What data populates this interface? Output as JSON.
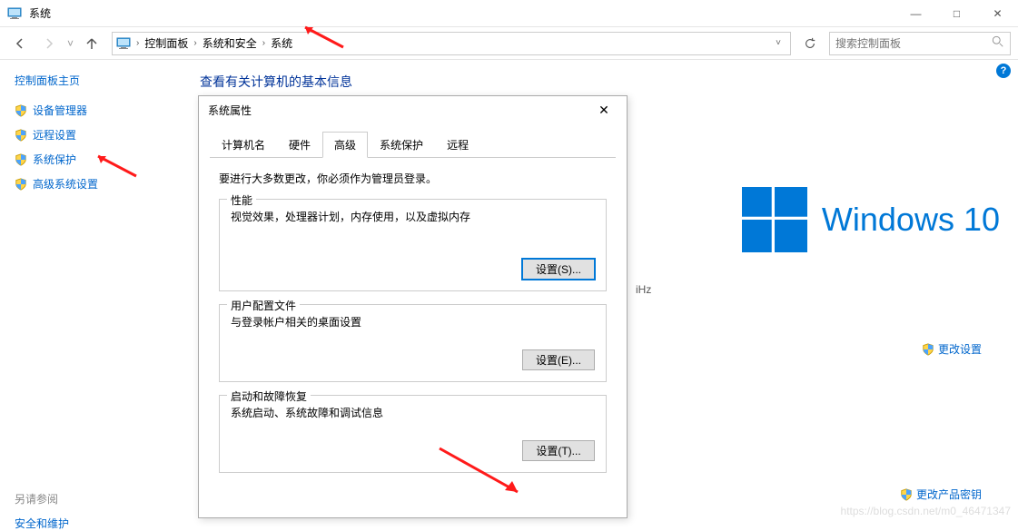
{
  "window": {
    "title": "系统",
    "minimize": "—",
    "maximize": "□",
    "close": "✕"
  },
  "nav": {
    "breadcrumbs": [
      "控制面板",
      "系统和安全",
      "系统"
    ],
    "search_placeholder": "搜索控制面板"
  },
  "sidebar": {
    "home": "控制面板主页",
    "items": [
      "设备管理器",
      "远程设置",
      "系统保护",
      "高级系统设置"
    ],
    "also_ref": "另请参阅",
    "sub": "安全和维护"
  },
  "content": {
    "heading": "查看有关计算机的基本信息",
    "ghz_snippet": "iHz",
    "win_brand": "Windows 10",
    "change_settings": "更改设置",
    "change_key": "更改产品密钥"
  },
  "dialog": {
    "title": "系统属性",
    "tabs": [
      "计算机名",
      "硬件",
      "高级",
      "系统保护",
      "远程"
    ],
    "active_tab": 2,
    "admin_note": "要进行大多数更改，你必须作为管理员登录。",
    "sections": [
      {
        "legend": "性能",
        "desc": "视觉效果，处理器计划，内存使用，以及虚拟内存",
        "btn": "设置(S)..."
      },
      {
        "legend": "用户配置文件",
        "desc": "与登录帐户相关的桌面设置",
        "btn": "设置(E)..."
      },
      {
        "legend": "启动和故障恢复",
        "desc": "系统启动、系统故障和调试信息",
        "btn": "设置(T)..."
      }
    ]
  },
  "watermark": "https://blog.csdn.net/m0_46471347"
}
